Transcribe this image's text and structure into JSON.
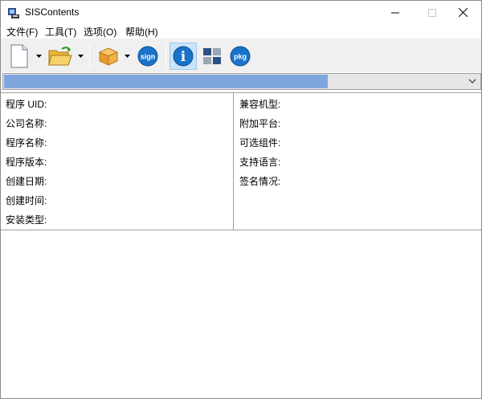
{
  "window": {
    "title": "SISContents",
    "controls": {
      "minimize": "minimize",
      "maximize": "maximize",
      "close": "close"
    }
  },
  "menu": {
    "items": [
      {
        "label": "文件(F)"
      },
      {
        "label": "工具(T)"
      },
      {
        "label": "选项(O)"
      },
      {
        "label": "帮助(H)"
      }
    ]
  },
  "toolbar": {
    "buttons": [
      {
        "icon": "new-document-icon"
      },
      {
        "icon": "dropdown-arrow-icon"
      },
      {
        "icon": "open-folder-icon"
      },
      {
        "icon": "dropdown-arrow-icon"
      },
      {
        "icon": "package-box-icon"
      },
      {
        "icon": "dropdown-arrow-icon"
      },
      {
        "icon": "sign-icon",
        "text": "sign"
      },
      {
        "icon": "info-icon",
        "text": "i",
        "active": true
      },
      {
        "icon": "tiles-icon"
      },
      {
        "icon": "pkg-icon",
        "text": "pkg"
      }
    ]
  },
  "progress": {
    "fraction": 0.68,
    "color": "#7fa7de"
  },
  "info": {
    "left_fields": [
      {
        "label": "程序 UID:"
      },
      {
        "label": "公司名称:"
      },
      {
        "label": "程序名称:"
      },
      {
        "label": "程序版本:"
      },
      {
        "label": "创建日期:"
      },
      {
        "label": "创建时间:"
      },
      {
        "label": "安装类型:"
      }
    ],
    "right_fields": [
      {
        "label": "兼容机型:"
      },
      {
        "label": "附加平台:"
      },
      {
        "label": "可选组件:"
      },
      {
        "label": "支持语言:"
      },
      {
        "label": "签名情况:"
      }
    ]
  },
  "colors": {
    "accent_blue": "#1a73c9",
    "toolbar_bg": "#f0f0f0",
    "active_bg": "#cce4f7"
  }
}
